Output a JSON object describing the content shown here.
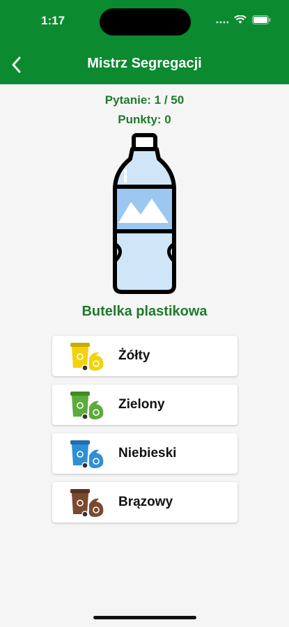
{
  "status_bar": {
    "time": "1:17"
  },
  "header": {
    "title": "Mistrz Segregacji",
    "back_icon": "chevron-left-icon"
  },
  "quiz": {
    "question": "Pytanie: 1 / 50",
    "points": "Punkty: 0",
    "item_name": "Butelka plastikowa",
    "item_icon": "plastic-bottle-icon"
  },
  "answers": [
    {
      "label": "Żółty",
      "color": "#f2d20d",
      "icon": "yellow-bin-icon"
    },
    {
      "label": "Zielony",
      "color": "#5dab3b",
      "icon": "green-bin-icon"
    },
    {
      "label": "Niebieski",
      "color": "#2f8fd6",
      "icon": "blue-bin-icon"
    },
    {
      "label": "Brązowy",
      "color": "#7a4a2e",
      "icon": "brown-bin-icon"
    }
  ],
  "colors": {
    "header": "#0b8a2f",
    "accent_text": "#1f7a2b",
    "background": "#f5f5f5"
  }
}
